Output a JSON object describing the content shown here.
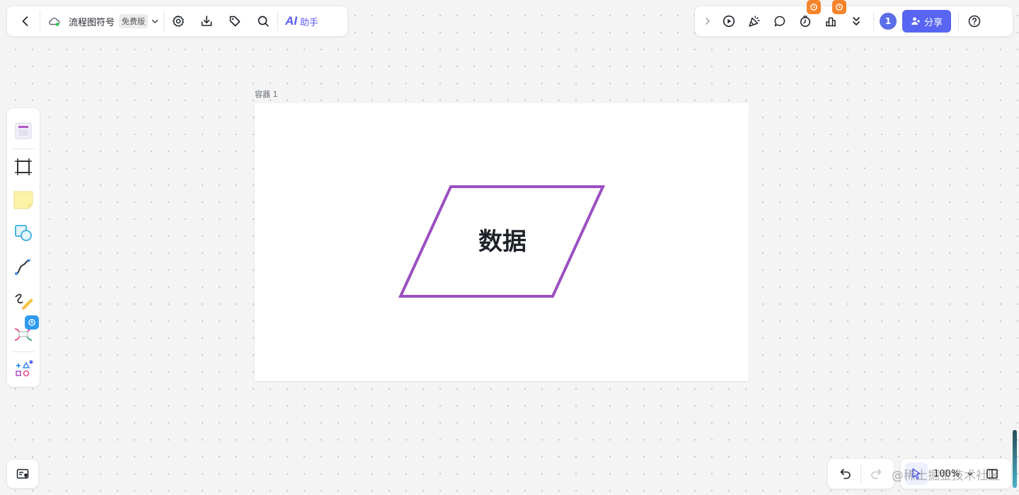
{
  "top_left": {
    "doc_title": "流程图符号",
    "plan_badge": "免费版",
    "ai_mark": "AI",
    "ai_label": "助手"
  },
  "top_right": {
    "avatar_count": "1",
    "share_label": "分享"
  },
  "canvas": {
    "container_label": "容器 1",
    "shape_text": "数据",
    "shape_stroke": "#9b4fc1"
  },
  "zoom": {
    "value": "100%"
  },
  "watermark": "@稀土掘金技术社区",
  "colors": {
    "accent": "#5865f2",
    "badge": "#f5832a"
  }
}
